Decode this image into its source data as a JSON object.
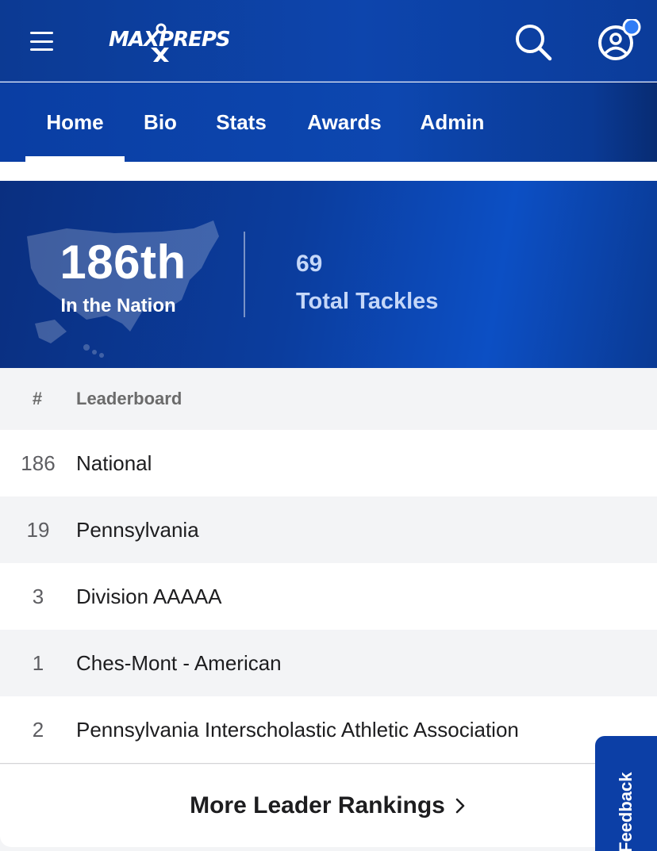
{
  "header": {
    "logo_text": "MAXPREPS",
    "menu_icon": "hamburger-menu-icon",
    "search_icon": "search-icon",
    "profile_icon": "user-account-icon",
    "notification_color": "#2f7cf6"
  },
  "tabs": [
    {
      "label": "Home",
      "active": true
    },
    {
      "label": "Bio",
      "active": false
    },
    {
      "label": "Stats",
      "active": false
    },
    {
      "label": "Awards",
      "active": false
    },
    {
      "label": "Admin",
      "active": false
    }
  ],
  "hero": {
    "rank": "186th",
    "rank_label": "In the Nation",
    "stat_value": "69",
    "stat_label": "Total Tackles"
  },
  "leaderboard": {
    "columns": {
      "rank": "#",
      "name": "Leaderboard"
    },
    "rows": [
      {
        "rank": "186",
        "name": "National"
      },
      {
        "rank": "19",
        "name": "Pennsylvania"
      },
      {
        "rank": "3",
        "name": "Division AAAAA"
      },
      {
        "rank": "1",
        "name": "Ches-Mont - American"
      },
      {
        "rank": "2",
        "name": "Pennsylvania Interscholastic Athletic Association"
      }
    ]
  },
  "more_link": "More Leader Rankings",
  "feedback": "Feedback",
  "colors": {
    "brand_blue": "#0c3fa6",
    "hero_text": "#c5d7f8"
  }
}
